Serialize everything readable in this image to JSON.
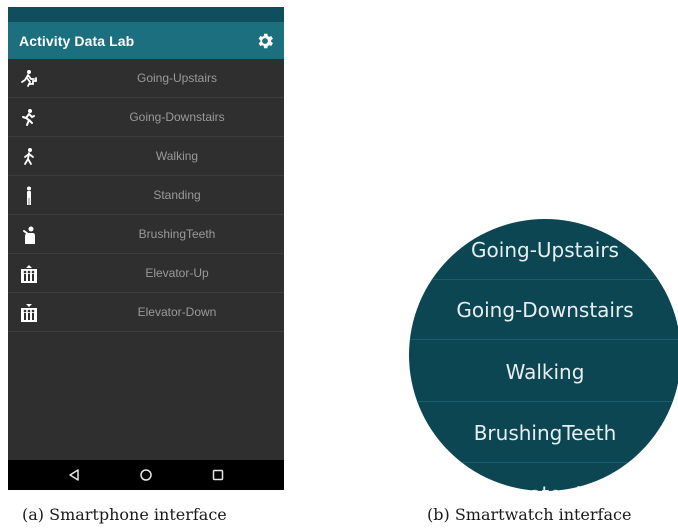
{
  "phone": {
    "app_title": "Activity Data Lab",
    "settings_icon": "gear-icon",
    "activities": [
      {
        "label": "Going-Upstairs",
        "icon": "stairs-up-icon"
      },
      {
        "label": "Going-Downstairs",
        "icon": "stairs-down-icon"
      },
      {
        "label": "Walking",
        "icon": "walking-icon"
      },
      {
        "label": "Standing",
        "icon": "standing-icon"
      },
      {
        "label": "BrushingTeeth",
        "icon": "brushing-teeth-icon"
      },
      {
        "label": "Elevator-Up",
        "icon": "elevator-up-icon"
      },
      {
        "label": "Elevator-Down",
        "icon": "elevator-down-icon"
      }
    ],
    "nav": [
      "back-icon",
      "home-icon",
      "recents-icon"
    ]
  },
  "watch": {
    "items": [
      "Going-Upstairs",
      "Going-Downstairs",
      "Walking",
      "BrushingTeeth",
      "Elevator-Up"
    ]
  },
  "captions": {
    "a": "(a) Smartphone interface",
    "b": "(b) Smartwatch interface"
  },
  "colors": {
    "app_bar": "#1b6f7f",
    "status_bar": "#0f4f5d",
    "list_bg": "#2f2f2f",
    "watch_bg": "#0c4653"
  }
}
